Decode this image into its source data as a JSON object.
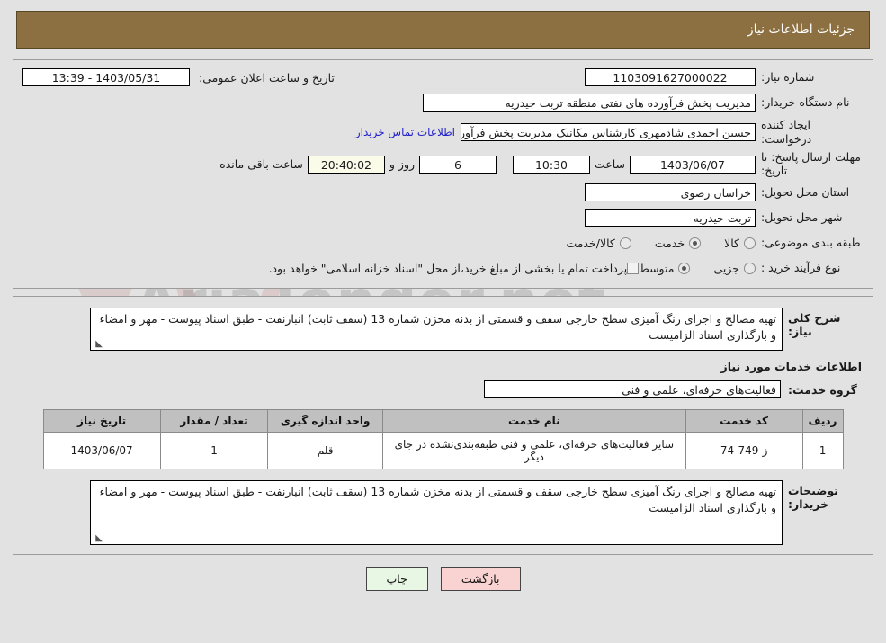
{
  "header": {
    "title": "جزئیات اطلاعات نیاز"
  },
  "form": {
    "need_number_label": "شماره نیاز:",
    "need_number_value": "1103091627000022",
    "announce_label": "تاریخ و ساعت اعلان عمومی:",
    "announce_value": "1403/05/31 - 13:39",
    "buyer_org_label": "نام دستگاه خریدار:",
    "buyer_org_value": "مدیریت پخش فرآورده های نفتی منطقه تربت حیدریه",
    "creator_label": "ایجاد کننده درخواست:",
    "creator_value": "حسین احمدی شادمهری کارشناس مکانیک مدیریت پخش فرآورده های نفتی منطقه تربت حیدریه",
    "contact_link": "اطلاعات تماس خریدار",
    "deadline_label": "مهلت ارسال پاسخ: تا تاریخ:",
    "deadline_date": "1403/06/07",
    "hour_label": "ساعت",
    "hour_value": "10:30",
    "days_value": "6",
    "days_label": "روز و",
    "remaining_value": "20:40:02",
    "remaining_label": "ساعت باقی مانده",
    "province_label": "استان محل تحویل:",
    "province_value": "خراسان رضوی",
    "city_label": "شهر محل تحویل:",
    "city_value": "تربت حیدریه",
    "category_label": "طبقه بندی موضوعی:",
    "category_options": [
      {
        "label": "کالا",
        "selected": false
      },
      {
        "label": "خدمت",
        "selected": true
      },
      {
        "label": "کالا/خدمت",
        "selected": false
      }
    ],
    "process_label": "نوع فرآیند خرید :",
    "process_options": [
      {
        "label": "جزیی",
        "selected": false
      },
      {
        "label": "متوسط",
        "selected": true
      }
    ],
    "treasury_checkbox_checked": false,
    "treasury_note": "پرداخت تمام یا بخشی از مبلغ خرید،از محل \"اسناد خزانه اسلامی\" خواهد بود."
  },
  "description": {
    "general_label": "شرح کلی نیاز:",
    "general_value": "تهیه مصالح و اجرای رنگ آمیزی سطح خارجی سقف و قسمتی از بدنه مخزن شماره 13 (سقف ثابت) انبارنفت - طبق اسناد پیوست - مهر و امضاء و بارگذاری اسناد الزامیست",
    "services_heading": "اطلاعات خدمات مورد نیاز",
    "service_group_label": "گروه خدمت:",
    "service_group_value": "فعالیت‌های حرفه‌ای، علمی و فنی"
  },
  "table": {
    "columns": [
      "ردیف",
      "کد خدمت",
      "نام خدمت",
      "واحد اندازه گیری",
      "تعداد / مقدار",
      "تاریخ نیاز"
    ],
    "rows": [
      {
        "radif": "1",
        "code": "ز-749-74",
        "name": "سایر فعالیت‌های حرفه‌ای، علمی و فنی طبقه‌بندی‌نشده در جای دیگر",
        "unit": "قلم",
        "qty": "1",
        "date": "1403/06/07"
      }
    ]
  },
  "buyer_notes": {
    "label": "توضیحات خریدار:",
    "value": "تهیه مصالح و اجرای رنگ آمیزی سطح خارجی سقف و قسمتی از بدنه مخزن شماره 13 (سقف ثابت) انبارنفت - طبق اسناد پیوست - مهر و امضاء و بارگذاری اسناد الزامیست"
  },
  "footer": {
    "print_label": "چاپ",
    "back_label": "بازگشت"
  },
  "watermark": {
    "text": "AriaTender.net"
  },
  "colors": {
    "header_bar": "#8d7041",
    "page_bg": "#e2e2e2",
    "table_header": "#c0c0c0",
    "link": "#2222cc",
    "print_button": "#e8f6e4",
    "back_button": "#f9d2d2",
    "countdown_field": "#fbfbea"
  }
}
